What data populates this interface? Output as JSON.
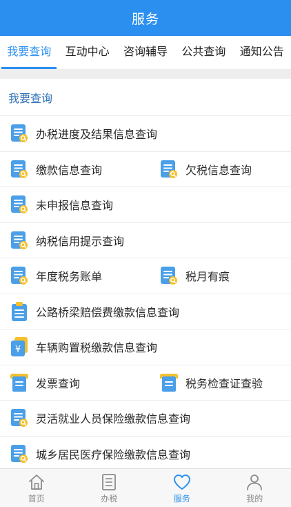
{
  "header": {
    "title": "服务"
  },
  "tabs": [
    {
      "label": "我要查询",
      "active": true
    },
    {
      "label": "互动中心",
      "active": false
    },
    {
      "label": "咨询辅导",
      "active": false
    },
    {
      "label": "公共查询",
      "active": false
    },
    {
      "label": "通知公告",
      "active": false
    }
  ],
  "section": {
    "title": "我要查询"
  },
  "items": {
    "progress_query": "办税进度及结果信息查询",
    "payment_query": "缴款信息查询",
    "arrears_query": "欠税信息查询",
    "undeclared_query": "未申报信息查询",
    "credit_query": "纳税信用提示查询",
    "annual_bill": "年度税务账单",
    "tax_trace": "税月有痕",
    "road_bridge_query": "公路桥梁赔偿费缴款信息查询",
    "vehicle_tax_query": "车辆购置税缴款信息查询",
    "invoice_query": "发票查询",
    "inspection_cert": "税务检查证查验",
    "flexible_insurance_query": "灵活就业人员保险缴款信息查询",
    "medical_insurance_query": "城乡居民医疗保险缴款信息查询"
  },
  "bottom_nav": {
    "home": "首页",
    "tax": "办税",
    "service": "服务",
    "mine": "我的"
  },
  "colors": {
    "primary": "#2b8ff0",
    "icon_blue": "#4a9fe8",
    "icon_yellow": "#f5c02c"
  }
}
